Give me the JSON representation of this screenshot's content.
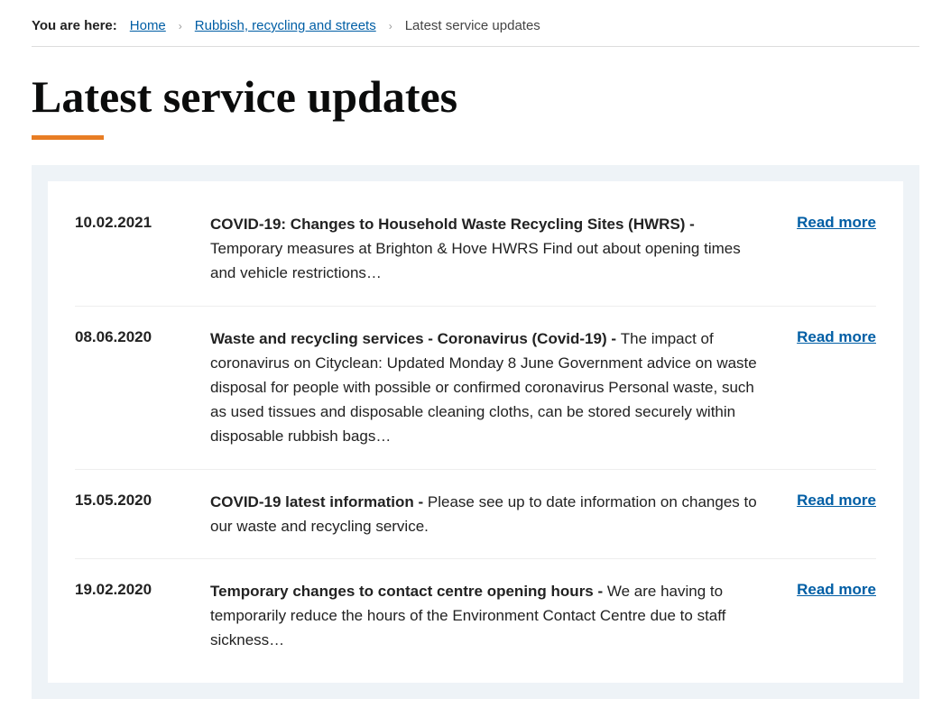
{
  "breadcrumb": {
    "label": "You are here:",
    "items": [
      {
        "text": "Home",
        "link": true
      },
      {
        "text": "Rubbish, recycling and streets",
        "link": true
      },
      {
        "text": "Latest service updates",
        "link": false
      }
    ]
  },
  "page": {
    "title": "Latest service updates"
  },
  "read_more_label": "Read more",
  "updates": [
    {
      "date": "10.02.2021",
      "title": "COVID-19: Changes to Household Waste Recycling Sites (HWRS) - ",
      "summary": "Temporary measures at Brighton & Hove HWRS Find out about opening times and vehicle restrictions…"
    },
    {
      "date": "08.06.2020",
      "title": "Waste and recycling services - Coronavirus (Covid-19) - ",
      "summary": "The impact of coronavirus on Cityclean: Updated Monday 8 June Government advice on waste disposal for people with possible or confirmed coronavirus Personal waste, such as used tissues and disposable cleaning cloths, can be stored securely within disposable rubbish bags…"
    },
    {
      "date": "15.05.2020",
      "title": "COVID-19 latest information - ",
      "summary": "Please see up to date information on changes to our waste and recycling service."
    },
    {
      "date": "19.02.2020",
      "title": "Temporary changes to contact centre opening hours - ",
      "summary": "We are having to temporarily reduce the hours of the Environment Contact Centre due to staff sickness…"
    }
  ]
}
